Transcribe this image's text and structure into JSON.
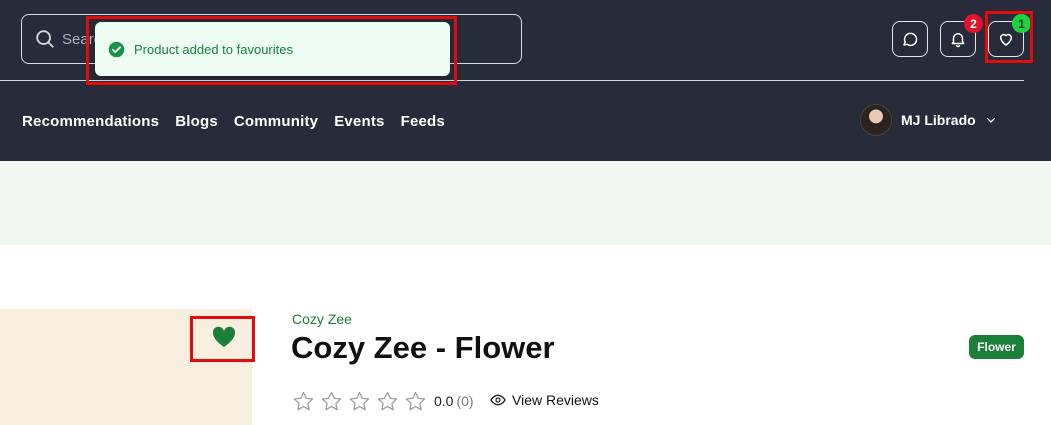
{
  "header": {
    "search": {
      "placeholder": "Search"
    },
    "notifications_count": "2",
    "favourites_count": "1"
  },
  "nav": {
    "cut_item": "s",
    "items": [
      "Recommendations",
      "Blogs",
      "Community",
      "Events",
      "Feeds"
    ]
  },
  "user": {
    "name": "MJ Librado"
  },
  "toast": {
    "message": "Product added to favourites"
  },
  "product": {
    "brand": "Cozy Zee",
    "title": "Cozy Zee - Flower",
    "category": "Flower",
    "rating_value": "0.0",
    "rating_count": "(0)",
    "stars": 5,
    "view_reviews_label": "View Reviews"
  },
  "colors": {
    "header_bg": "#272b3a",
    "accent_green": "#1a7f37",
    "toast_bg": "#edfdf3",
    "badge_red": "#e3122a",
    "badge_green": "#1fd240",
    "highlight_red": "#e10c0c"
  },
  "icons": [
    "search-icon",
    "chat-icon",
    "bell-icon",
    "heart-icon",
    "chevron-down-icon",
    "check-circle-icon",
    "star-icon",
    "eye-icon"
  ]
}
